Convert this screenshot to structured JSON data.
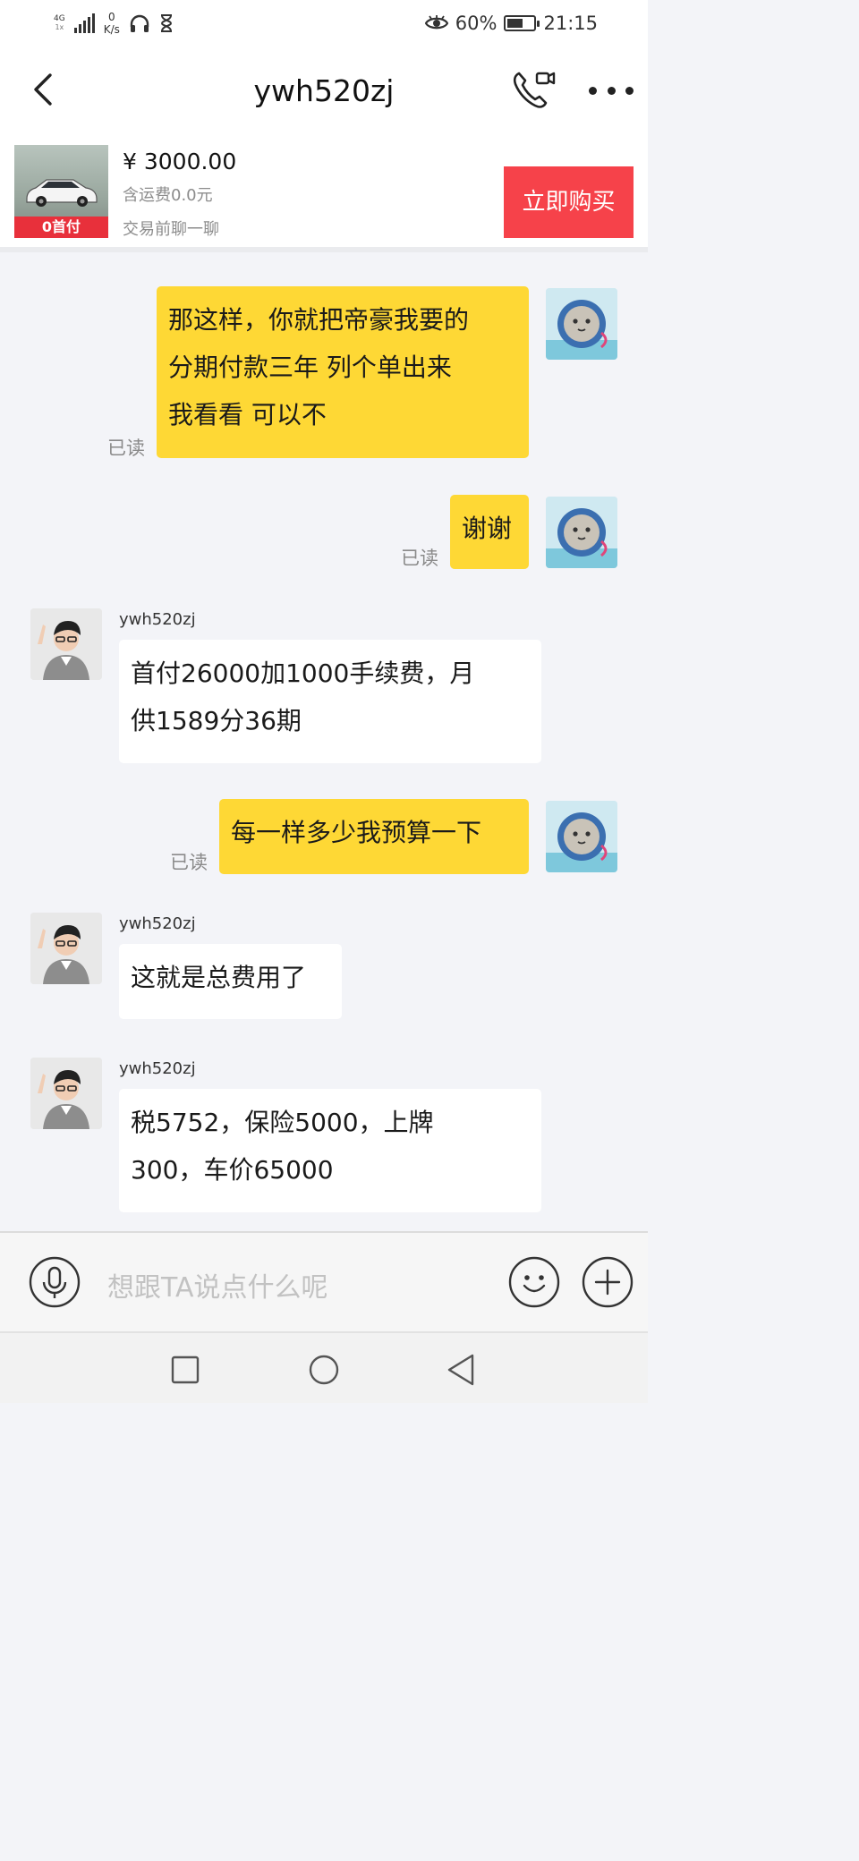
{
  "status_bar": {
    "network_type": "4G",
    "network_sub": "1x",
    "speed_value": "0",
    "speed_unit": "K/s",
    "battery": "60%",
    "battery_level": 0.6,
    "time": "21:15",
    "icons": [
      "signal-icon",
      "headphones-icon",
      "hourglass-icon",
      "eye-icon",
      "battery-icon"
    ]
  },
  "header": {
    "title": "ywh520zj",
    "back_icon": "back-arrow-icon",
    "call_icon": "phone-video-icon",
    "more_icon": "more-dots-icon"
  },
  "product": {
    "thumb_badge": "0首付",
    "price": "¥ 3000.00",
    "shipping": "含运费0.0元",
    "hint": "交易前聊一聊",
    "buy_label": "立即购买",
    "buy_color": "#f6424a"
  },
  "messages": [
    {
      "from": "me",
      "text": "那这样，你就把帝豪我要的\n分期付款三年 列个单出来\n我看看 可以不",
      "read_label": "已读"
    },
    {
      "from": "me",
      "text": "谢谢",
      "read_label": "已读"
    },
    {
      "from": "other",
      "sender": "ywh520zj",
      "text": "首付26000加1000手续费，月\n供1589分36期"
    },
    {
      "from": "me",
      "text": "每一样多少我预算一下",
      "read_label": "已读"
    },
    {
      "from": "other",
      "sender": "ywh520zj",
      "text": "这就是总费用了"
    },
    {
      "from": "other",
      "sender": "ywh520zj",
      "text": "税5752，保险5000，上牌\n300，车价65000"
    }
  ],
  "composer": {
    "placeholder": "想跟TA说点什么呢",
    "mic_icon": "microphone-icon",
    "emoji_icon": "smiley-icon",
    "plus_icon": "plus-icon"
  },
  "nav_bar": {
    "recent_icon": "square-recent-icon",
    "home_icon": "circle-home-icon",
    "back_icon": "triangle-back-icon"
  },
  "colors": {
    "my_bubble": "#fed835",
    "other_bubble": "#ffffff",
    "chat_bg": "#f3f4f8",
    "accent_red": "#f6424a"
  }
}
